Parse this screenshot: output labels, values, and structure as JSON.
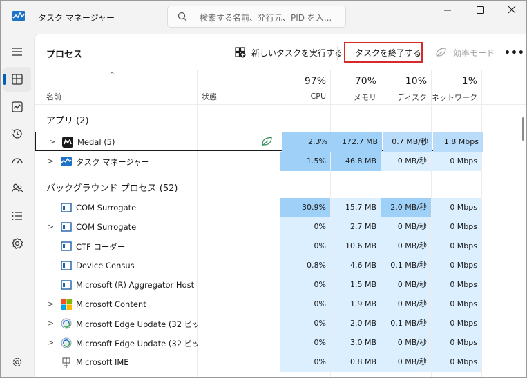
{
  "window": {
    "title": "タスク マネージャー",
    "search_placeholder": "検索する名前、発行元、PID を入..."
  },
  "toolbar": {
    "page_title": "プロセス",
    "run_task_label": "新しいタスクを実行する",
    "end_task_label": "タスクを終了する",
    "efficiency_label": "効率モード",
    "more_label": "•••"
  },
  "sidebar": {
    "items": [
      "hamburger-menu",
      "processes",
      "performance",
      "app-history",
      "startup-apps",
      "users",
      "details",
      "services",
      "settings"
    ]
  },
  "columns": {
    "name": "名前",
    "status": "状態",
    "cpu": {
      "pct": "97%",
      "label": "CPU"
    },
    "memory": {
      "pct": "70%",
      "label": "メモリ"
    },
    "disk": {
      "pct": "10%",
      "label": "ディスク"
    },
    "network": {
      "pct": "1%",
      "label": "ネットワーク"
    }
  },
  "groups": {
    "apps": "アプリ (2)",
    "background": "バックグラウンド プロセス (52)"
  },
  "apps": [
    {
      "name": "Medal (5)",
      "cpu": "2.3%",
      "mem": "172.7 MB",
      "disk": "0.7 MB/秒",
      "net": "1.8 Mbps"
    },
    {
      "name": "タスク マネージャー",
      "cpu": "1.5%",
      "mem": "46.8 MB",
      "disk": "0 MB/秒",
      "net": "0 Mbps"
    }
  ],
  "background": [
    {
      "name": "COM Surrogate",
      "cpu": "30.9%",
      "mem": "15.7 MB",
      "disk": "2.0 MB/秒",
      "net": "0 Mbps"
    },
    {
      "name": "COM Surrogate",
      "cpu": "0%",
      "mem": "2.7 MB",
      "disk": "0 MB/秒",
      "net": "0 Mbps"
    },
    {
      "name": "CTF ローダー",
      "cpu": "0%",
      "mem": "10.6 MB",
      "disk": "0 MB/秒",
      "net": "0 Mbps"
    },
    {
      "name": "Device Census",
      "cpu": "0.8%",
      "mem": "4.6 MB",
      "disk": "0.1 MB/秒",
      "net": "0 Mbps"
    },
    {
      "name": "Microsoft (R) Aggregator Host",
      "cpu": "0%",
      "mem": "1.5 MB",
      "disk": "0 MB/秒",
      "net": "0 Mbps"
    },
    {
      "name": "Microsoft Content",
      "cpu": "0%",
      "mem": "1.9 MB",
      "disk": "0 MB/秒",
      "net": "0 Mbps"
    },
    {
      "name": "Microsoft Edge Update (32 ビッ...",
      "cpu": "0%",
      "mem": "2.0 MB",
      "disk": "0.1 MB/秒",
      "net": "0 Mbps"
    },
    {
      "name": "Microsoft Edge Update (32 ビッ...",
      "cpu": "0%",
      "mem": "3.0 MB",
      "disk": "0 MB/秒",
      "net": "0 Mbps"
    },
    {
      "name": "Microsoft IME",
      "cpu": "0%",
      "mem": "0.8 MB",
      "disk": "0 MB/秒",
      "net": "0 Mbps"
    }
  ],
  "colors": {
    "accent": "#005fb8",
    "end_task_outline": "#d62a2a",
    "heat_low": "#dbefff",
    "heat_mid": "#b9dcfa",
    "heat_high": "#9fd0f8"
  }
}
